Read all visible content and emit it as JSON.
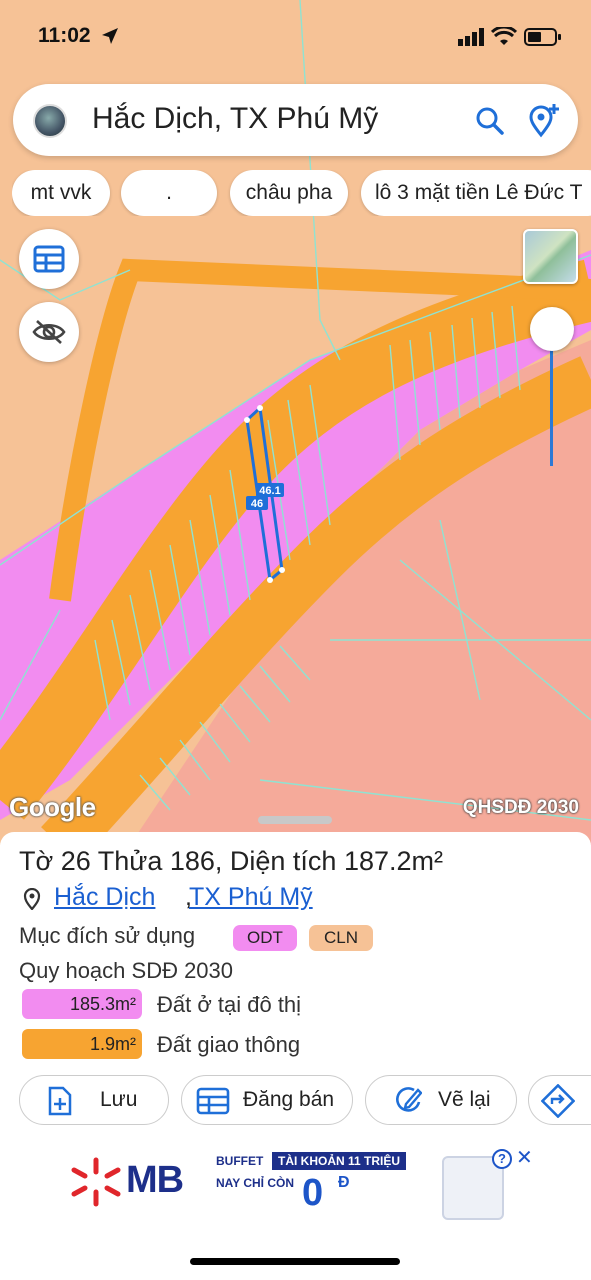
{
  "status_bar": {
    "time": "11:02"
  },
  "search": {
    "query": "Hắc Dịch, TX Phú Mỹ"
  },
  "chips": [
    "mt vvk",
    ".",
    "châu pha",
    "lô 3 mặt tiền Lê Đức T"
  ],
  "map": {
    "dim_label_1": "46.1",
    "dim_label_2": "46",
    "google_logo": "Google",
    "layer_badge": "QHSDĐ 2030",
    "colors": {
      "residential": "#f28cf0",
      "transport": "#f7a431",
      "other": "#f5aa9a",
      "background": "#f6c296"
    }
  },
  "parcel": {
    "title": "Tờ 26 Thửa 186, Diện tích 187.2m²",
    "address_link_1": "Hắc Dịch",
    "address_sep": ",",
    "address_link_2": "TX Phú Mỹ",
    "purpose_label": "Mục đích sử dụng",
    "purpose_tags": [
      {
        "text": "ODT",
        "color": "#f28cf0"
      },
      {
        "text": "CLN",
        "color": "#f6c296"
      }
    ],
    "plan_label": "Quy hoạch SDĐ 2030",
    "plan_items": [
      {
        "value": "185.3m²",
        "label": "Đất ở tại đô thị",
        "color": "#f28cf0"
      },
      {
        "value": "1.9m²",
        "label": "Đất giao thông",
        "color": "#f7a431"
      }
    ]
  },
  "actions": [
    {
      "label": "Lưu",
      "icon": "add-document-icon"
    },
    {
      "label": "Đăng bán",
      "icon": "listing-icon"
    },
    {
      "label": "Vẽ lại",
      "icon": "redraw-icon"
    },
    {
      "label": "",
      "icon": "directions-icon"
    }
  ],
  "ad": {
    "brand": "MB",
    "line1": "BUFFET",
    "line1_highlight": "TÀI KHOẢN 11 TRIỆU",
    "line2": "NAY CHỈ CÒN",
    "price": "0",
    "currency": "Đ"
  }
}
